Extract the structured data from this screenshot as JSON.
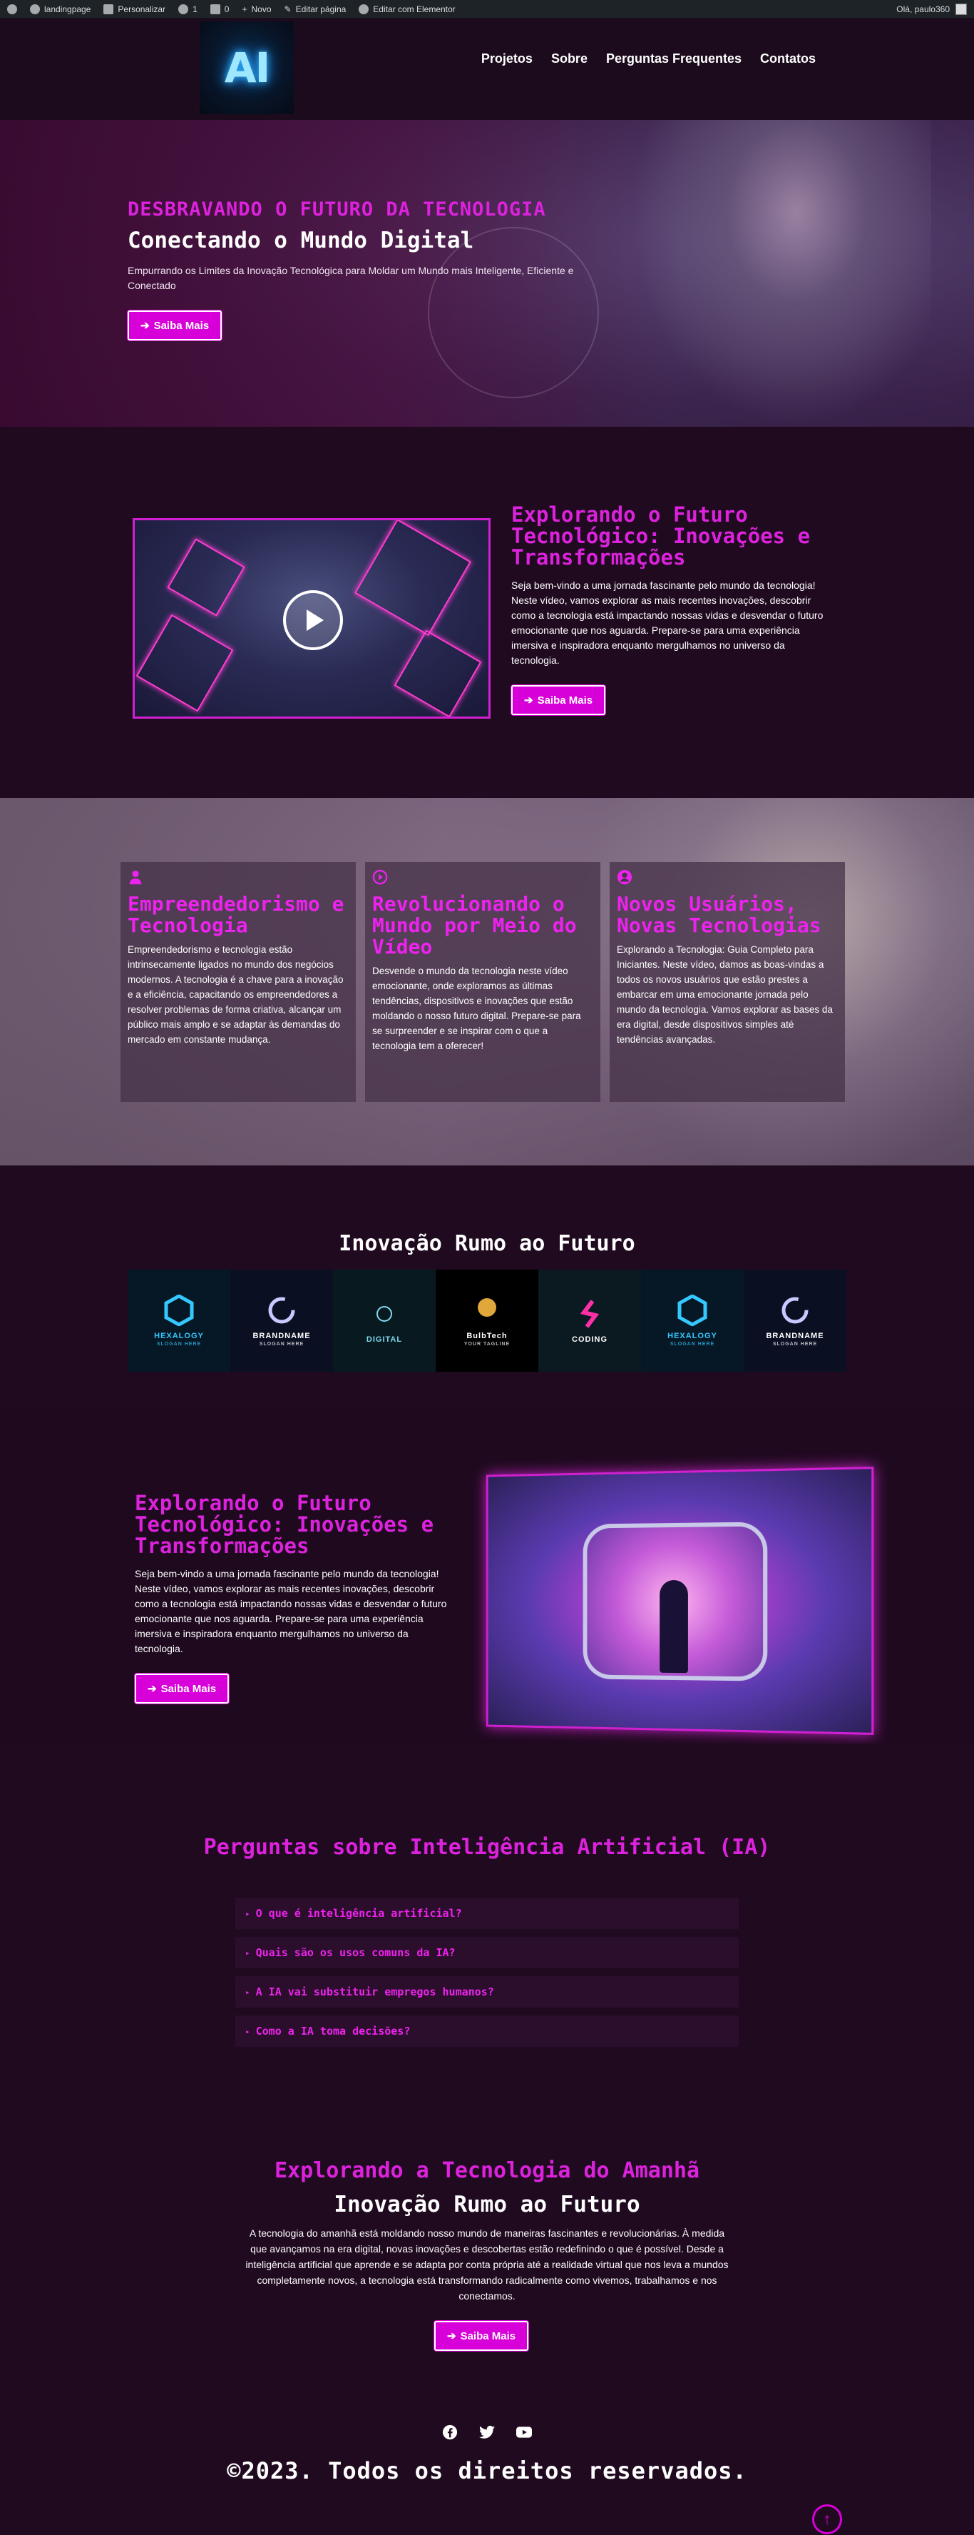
{
  "adminbar": {
    "site": "landingpage",
    "customize": "Personalizar",
    "updates": "1",
    "comments": "0",
    "new": "Novo",
    "edit_page": "Editar página",
    "edit_elementor": "Editar com Elementor",
    "greeting": "Olá, paulo360"
  },
  "header": {
    "logo_text": "AI",
    "nav": [
      "Projetos",
      "Sobre",
      "Perguntas Frequentes",
      "Contatos"
    ]
  },
  "hero": {
    "kicker": "DESBRAVANDO O FUTURO DA TECNOLOGIA",
    "title": "Conectando o Mundo Digital",
    "text": "Empurrando os Limites da Inovação Tecnológica para Moldar um Mundo mais Inteligente, Eficiente e Conectado",
    "button": "Saiba Mais"
  },
  "video_section": {
    "title": "Explorando o Futuro Tecnológico: Inovações e Transformações",
    "text": "Seja bem-vindo a uma jornada fascinante pelo mundo da tecnologia! Neste vídeo, vamos explorar as mais recentes inovações, descobrir como a tecnologia está impactando nossas vidas e desvendar o futuro emocionante que nos aguarda. Prepare-se para uma experiência imersiva e inspiradora enquanto mergulhamos no universo da tecnologia.",
    "button": "Saiba Mais"
  },
  "cards": [
    {
      "icon": "user-icon",
      "title": "Empreendedorismo e Tecnologia",
      "text": "Empreendedorismo e tecnologia estão intrinsecamente ligados no mundo dos negócios modernos. A tecnologia é a chave para a inovação e a eficiência, capacitando os empreendedores a resolver problemas de forma criativa, alcançar um público mais amplo e se adaptar às demandas do mercado em constante mudança."
    },
    {
      "icon": "play-circle-icon",
      "title": "Revolucionando o Mundo por Meio do Vídeo",
      "text": "Desvende o mundo da tecnologia neste vídeo emocionante, onde exploramos as últimas tendências, dispositivos e inovações que estão moldando o nosso futuro digital. Prepare-se para se surpreender e se inspirar com o que a tecnologia tem a oferecer!"
    },
    {
      "icon": "user-circle-icon",
      "title": "Novos Usuários, Novas Tecnologias",
      "text": "Explorando a Tecnologia: Guia Completo para Iniciantes. Neste vídeo, damos as boas-vindas a todos os novos usuários que estão prestes a embarcar em uma emocionante jornada pelo mundo da tecnologia. Vamos explorar as bases da era digital, desde dispositivos simples até tendências avançadas."
    }
  ],
  "brands": {
    "title": "Inovação Rumo ao Futuro",
    "items": [
      {
        "name": "HEXALOGY",
        "tag": "SLOGAN HERE",
        "bg": "#061826",
        "color": "#35c8ff",
        "icon": "hexagon-icon"
      },
      {
        "name": "BRANDNAME",
        "tag": "SLOGAN HERE",
        "bg": "#0a0f22",
        "color": "#ffffff",
        "icon": "ring-icon"
      },
      {
        "name": "DIGITAL",
        "tag": "",
        "bg": "#081a20",
        "color": "#7fd8f0",
        "icon": "digital-icon"
      },
      {
        "name": "BulbTech",
        "tag": "YOUR TAGLINE",
        "bg": "#000000",
        "color": "#ffffff",
        "icon": "bulb-icon"
      },
      {
        "name": "CODING",
        "tag": "",
        "bg": "#0b1a20",
        "color": "#ffffff",
        "icon": "code-icon"
      },
      {
        "name": "HEXALOGY",
        "tag": "SLOGAN HERE",
        "bg": "#061826",
        "color": "#35c8ff",
        "icon": "hexagon-icon"
      },
      {
        "name": "BRANDNAME",
        "tag": "SLOGAN HERE",
        "bg": "#0a0f22",
        "color": "#ffffff",
        "icon": "ring-icon"
      }
    ]
  },
  "feature2": {
    "title": "Explorando o Futuro Tecnológico: Inovações e Transformações",
    "text": "Seja bem-vindo a uma jornada fascinante pelo mundo da tecnologia! Neste vídeo, vamos explorar as mais recentes inovações, descobrir como a tecnologia está impactando nossas vidas e desvendar o futuro emocionante que nos aguarda. Prepare-se para uma experiência imersiva e inspiradora enquanto mergulhamos no universo da tecnologia.",
    "button": "Saiba Mais"
  },
  "faq": {
    "title": "Perguntas sobre Inteligência Artificial (IA)",
    "items": [
      "O que é inteligência artificial?",
      "Quais são os usos comuns da IA?",
      "A IA vai substituir empregos humanos?",
      "Como a IA toma decisões?"
    ]
  },
  "cta": {
    "kicker": "Explorando a Tecnologia do Amanhã",
    "title": "Inovação Rumo ao Futuro",
    "text": "A tecnologia do amanhã está moldando nosso mundo de maneiras fascinantes e revolucionárias. À medida que avançamos na era digital, novas inovações e descobertas estão redefinindo o que é possível. Desde a inteligência artificial que aprende e se adapta por conta própria até a realidade virtual que nos leva a mundos completamente novos, a tecnologia está transformando radicalmente como vivemos, trabalhamos e nos conectamos.",
    "button": "Saiba Mais"
  },
  "footer": {
    "socials": [
      "facebook-icon",
      "twitter-icon",
      "youtube-icon"
    ],
    "copyright": "©2023. Todos os direitos reservados.",
    "to_top": "↑"
  },
  "colors": {
    "accent": "#d800d8",
    "background": "#200a20",
    "admin_bar": "#1d2327"
  }
}
